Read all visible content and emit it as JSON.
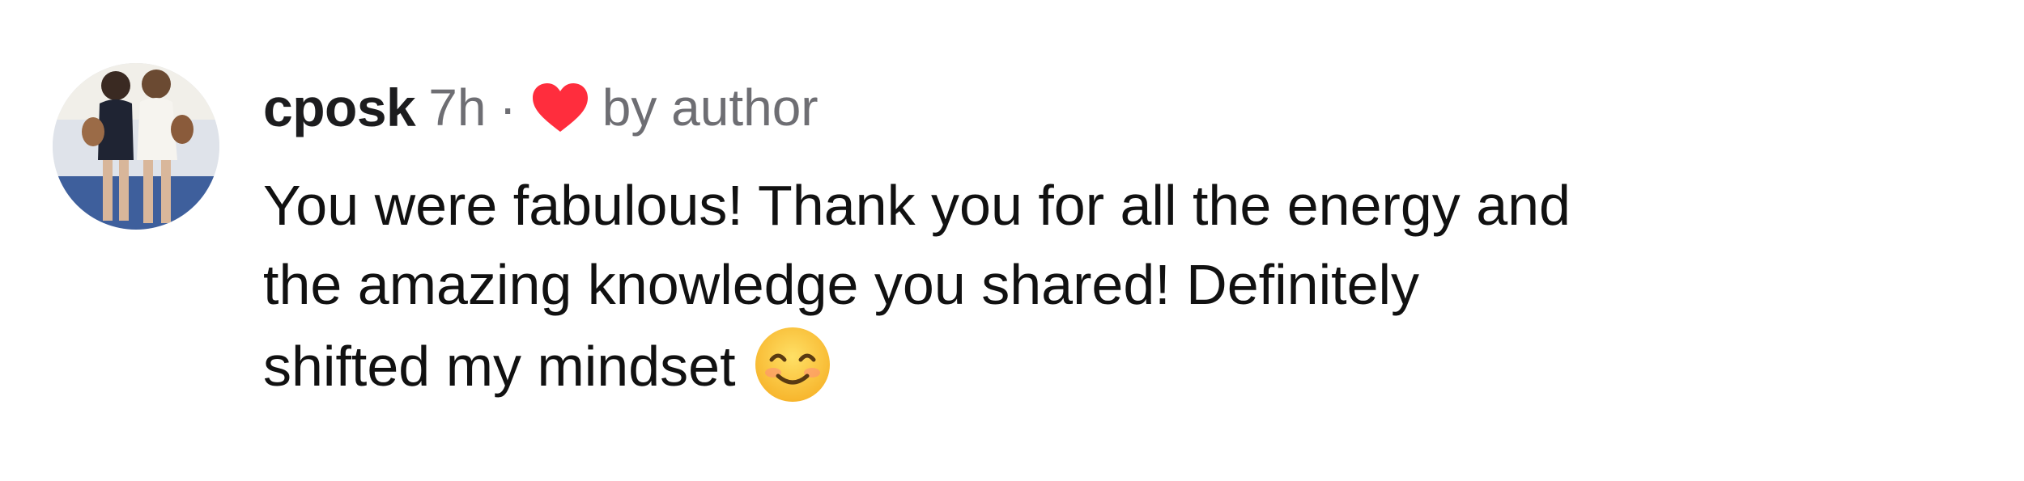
{
  "comment": {
    "username": "cposk",
    "timestamp": "7h",
    "separator": "·",
    "liked_label": "by author",
    "lines": [
      "You were fabulous! Thank you for all the energy and",
      "the amazing knowledge you shared! Definitely",
      "shifted my mindset"
    ],
    "emoji": "smiling-face-with-smiling-eyes-icon"
  },
  "colors": {
    "heart": "#ff2d3d",
    "username": "#1c1c1e",
    "meta": "#6e6e73",
    "text": "#111111"
  }
}
